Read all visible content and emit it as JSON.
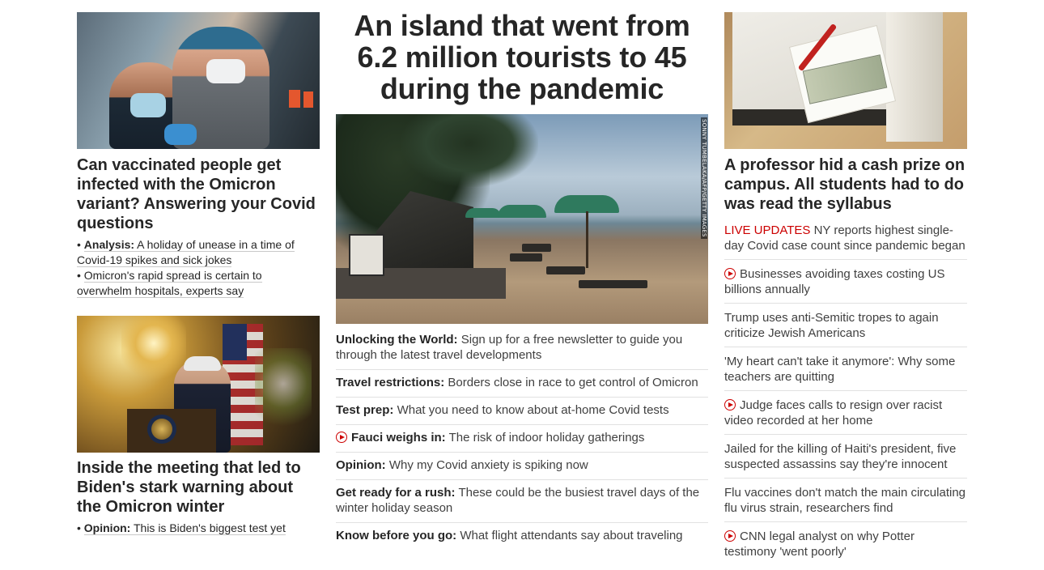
{
  "left": {
    "story1": {
      "image_alt": "vaccination photo",
      "headline": "Can vaccinated people get infected with the Omicron variant? Answering your Covid questions",
      "bullets": [
        {
          "label": "Analysis:",
          "text": "A holiday of unease in a time of Covid-19 spikes and sick jokes"
        },
        {
          "label": "",
          "text": "Omicron's rapid spread is certain to overwhelm hospitals, experts say"
        }
      ]
    },
    "story2": {
      "headline": "Inside the meeting that led to Biden's stark warning about the Omicron winter",
      "bullets": [
        {
          "label": "Opinion:",
          "text": "This is Biden's biggest test yet"
        }
      ]
    }
  },
  "middle": {
    "title": "An island that went from 6.2 million tourists to 45 during the pandemic",
    "photo_credit": "SONNY TUMBELAKA/AFP/GETTY IMAGES",
    "items": [
      {
        "label": "Unlocking the World:",
        "text": "Sign up for a free newsletter to guide you through the latest travel developments",
        "video": false
      },
      {
        "label": "Travel restrictions:",
        "text": "Borders close in race to get control of Omicron",
        "video": false
      },
      {
        "label": "Test prep:",
        "text": "What you need to know about at-home Covid tests",
        "video": false
      },
      {
        "label": "Fauci weighs in:",
        "text": "The risk of indoor holiday gatherings",
        "video": true
      },
      {
        "label": "Opinion:",
        "text": "Why my Covid anxiety is spiking now",
        "video": false
      },
      {
        "label": "Get ready for a rush:",
        "text": "These could be the busiest travel days of the winter holiday season",
        "video": false
      },
      {
        "label": "Know before you go:",
        "text": "What flight attendants say about traveling",
        "video": false
      }
    ]
  },
  "right": {
    "headline": "A professor hid a cash prize on campus. All students had to do was read the syllabus",
    "items": [
      {
        "prefix": "LIVE UPDATES",
        "text": "NY reports highest single-day Covid case count since pandemic began",
        "video": false
      },
      {
        "prefix": "",
        "text": "Businesses avoiding taxes costing US billions annually",
        "video": true
      },
      {
        "prefix": "",
        "text": "Trump uses anti-Semitic tropes to again criticize Jewish Americans",
        "video": false
      },
      {
        "prefix": "",
        "text": "'My heart can't take it anymore': Why some teachers are quitting",
        "video": false
      },
      {
        "prefix": "",
        "text": "Judge faces calls to resign over racist video recorded at her home",
        "video": true
      },
      {
        "prefix": "",
        "text": "Jailed for the killing of Haiti's president, five suspected assassins say they're innocent",
        "video": false
      },
      {
        "prefix": "",
        "text": "Flu vaccines don't match the main circulating flu virus strain, researchers find",
        "video": false
      },
      {
        "prefix": "",
        "text": "CNN legal analyst on why Potter testimony 'went poorly'",
        "video": true
      }
    ]
  },
  "colors": {
    "accent_red": "#cc0000",
    "headline": "#262626",
    "body": "#404040",
    "divider": "#e1e1e1"
  },
  "icons": {
    "video": "play-circle-icon"
  }
}
